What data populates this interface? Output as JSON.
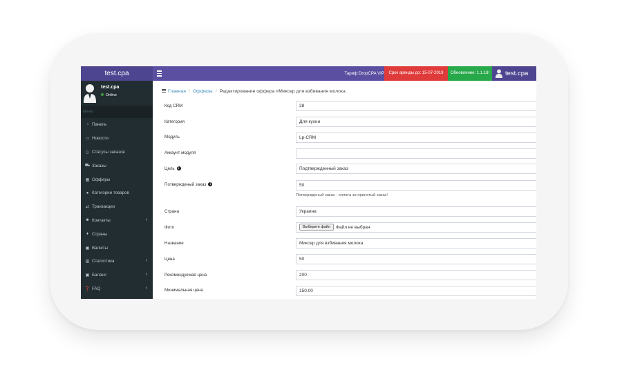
{
  "topbar": {
    "brand": "test.cpa",
    "tariff": "Тариф:DropCPA VIP",
    "lease": "Срок аренды до: 15-07-2019",
    "update": "Обновление: 1.1.18!",
    "user": "test.cpa"
  },
  "sidebar": {
    "user_name": "test.cpa",
    "user_status": "Online",
    "menu_header": "Меню",
    "items": [
      {
        "label": "Панель",
        "icon": "dashboard-icon"
      },
      {
        "label": "Новости",
        "icon": "news-icon"
      },
      {
        "label": "Статусы заказов",
        "icon": "file-icon"
      },
      {
        "label": "Заказы",
        "icon": "cart-icon"
      },
      {
        "label": "Офферы",
        "icon": "grid-icon"
      },
      {
        "label": "Категории товаров",
        "icon": "info-icon"
      },
      {
        "label": "Транзакции",
        "icon": "exchange-icon"
      },
      {
        "label": "Контакты",
        "icon": "users-icon"
      },
      {
        "label": "Страны",
        "icon": "map-marker-icon"
      },
      {
        "label": "Валюты",
        "icon": "money-icon"
      },
      {
        "label": "Статистика",
        "icon": "bar-chart-icon"
      },
      {
        "label": "Баланс",
        "icon": "money-icon"
      },
      {
        "label": "FAQ",
        "icon": "question-icon"
      }
    ]
  },
  "breadcrumb": {
    "home": "Главная",
    "offers": "Офферы",
    "current": "Редактирование оффера #Миксер для взбивания молока"
  },
  "form": {
    "crm_code": {
      "label": "Код CRM",
      "value": "38"
    },
    "category": {
      "label": "Категория",
      "value": "Для кухни"
    },
    "module": {
      "label": "Модуль",
      "value": "Lp-CRM"
    },
    "module_account": {
      "label": "Аккаунт модуля",
      "value": ""
    },
    "goal": {
      "label": "Цель",
      "value": "Подтвержденный заказ"
    },
    "confirmed_order": {
      "label": "Потвержденый заказ",
      "value": "50",
      "help": "Потвержденый заказ - оплата за принятый заказ!"
    },
    "country": {
      "label": "Страна",
      "value": "Украина"
    },
    "photo": {
      "label": "Фото",
      "button": "Выберите файл",
      "status": "Файл не выбран"
    },
    "name": {
      "label": "Название",
      "value": "Миксер для взбивания молока"
    },
    "price": {
      "label": "Цена",
      "value": "50"
    },
    "recommended_price": {
      "label": "Рекомендуемая цена",
      "value": "200"
    },
    "min_price": {
      "label": "Минимальная цена",
      "value": "150.00"
    }
  },
  "colors": {
    "header": "#5a4fa0",
    "lease": "#e03b3b",
    "update": "#27a849",
    "sidebar": "#222d32",
    "link": "#3c8dbc"
  }
}
